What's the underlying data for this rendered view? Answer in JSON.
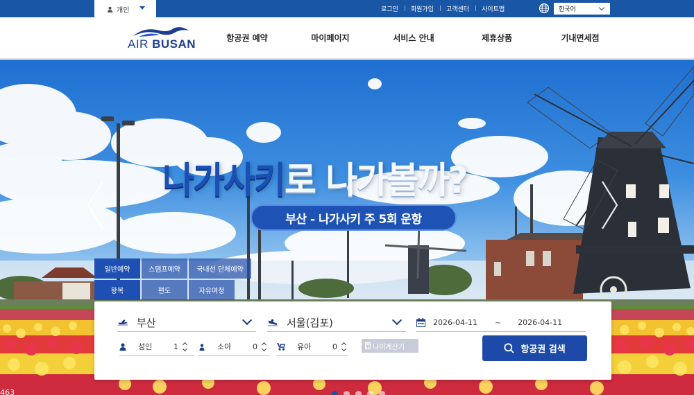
{
  "topbar": {
    "persona_label": "개인",
    "links": [
      "로그인",
      "회원가입",
      "고객센터",
      "사이트맵"
    ],
    "language": "한국어"
  },
  "header": {
    "logo_text_light": "AIR ",
    "logo_text_bold": "BUSAN",
    "nav": [
      "항공권 예약",
      "마이페이지",
      "서비스 안내",
      "제휴상품",
      "기내면세점"
    ]
  },
  "hero": {
    "headline_blue": "나가사키",
    "headline_white": "로 나가볼까?",
    "subtitle": "부산 - 나가사키 주 5회 운항",
    "watermark": "463",
    "slide_count": 5,
    "active_slide": 1
  },
  "booking": {
    "trip_tabs_row1": [
      "일반예약",
      "스탬프예약",
      "국내선 단체예약"
    ],
    "trip_tabs_row2": [
      "왕복",
      "편도",
      "자유여정"
    ],
    "origin": "부산",
    "destination": "서울(김포)",
    "depart_date": "2026-04-11",
    "return_date": "2026-04-11",
    "date_separator": "~",
    "passengers": [
      {
        "label": "성인",
        "count": "1"
      },
      {
        "label": "소아",
        "count": "0"
      },
      {
        "label": "유아",
        "count": "0"
      }
    ],
    "age_calc_label": "나이계산기",
    "search_label": "항공권 검색"
  },
  "colors": {
    "brand_blue": "#1a56a6",
    "button_blue": "#1d4aa8",
    "logo_navy": "#1d3d8f"
  },
  "icons": [
    "user-icon",
    "caret-down-icon",
    "globe-icon",
    "chevron-left-icon",
    "chevron-right-icon",
    "plane-takeoff-icon",
    "plane-landing-icon",
    "calendar-icon",
    "person-icon",
    "baby-stroller-icon",
    "calculator-icon",
    "search-icon"
  ]
}
